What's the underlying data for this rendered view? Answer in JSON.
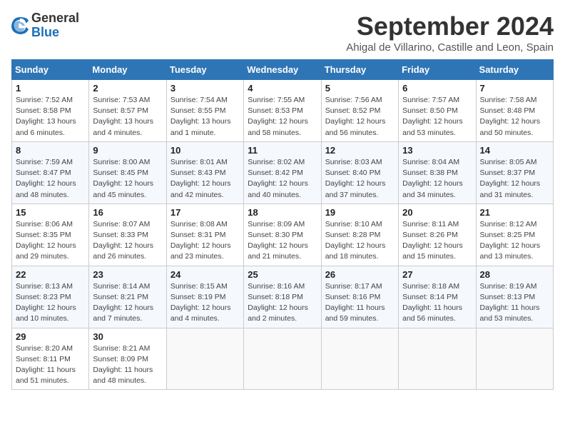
{
  "header": {
    "logo": {
      "line1": "General",
      "line2": "Blue"
    },
    "title": "September 2024",
    "subtitle": "Ahigal de Villarino, Castille and Leon, Spain"
  },
  "weekdays": [
    "Sunday",
    "Monday",
    "Tuesday",
    "Wednesday",
    "Thursday",
    "Friday",
    "Saturday"
  ],
  "weeks": [
    [
      {
        "day": "1",
        "info": "Sunrise: 7:52 AM\nSunset: 8:58 PM\nDaylight: 13 hours\nand 6 minutes."
      },
      {
        "day": "2",
        "info": "Sunrise: 7:53 AM\nSunset: 8:57 PM\nDaylight: 13 hours\nand 4 minutes."
      },
      {
        "day": "3",
        "info": "Sunrise: 7:54 AM\nSunset: 8:55 PM\nDaylight: 13 hours\nand 1 minute."
      },
      {
        "day": "4",
        "info": "Sunrise: 7:55 AM\nSunset: 8:53 PM\nDaylight: 12 hours\nand 58 minutes."
      },
      {
        "day": "5",
        "info": "Sunrise: 7:56 AM\nSunset: 8:52 PM\nDaylight: 12 hours\nand 56 minutes."
      },
      {
        "day": "6",
        "info": "Sunrise: 7:57 AM\nSunset: 8:50 PM\nDaylight: 12 hours\nand 53 minutes."
      },
      {
        "day": "7",
        "info": "Sunrise: 7:58 AM\nSunset: 8:48 PM\nDaylight: 12 hours\nand 50 minutes."
      }
    ],
    [
      {
        "day": "8",
        "info": "Sunrise: 7:59 AM\nSunset: 8:47 PM\nDaylight: 12 hours\nand 48 minutes."
      },
      {
        "day": "9",
        "info": "Sunrise: 8:00 AM\nSunset: 8:45 PM\nDaylight: 12 hours\nand 45 minutes."
      },
      {
        "day": "10",
        "info": "Sunrise: 8:01 AM\nSunset: 8:43 PM\nDaylight: 12 hours\nand 42 minutes."
      },
      {
        "day": "11",
        "info": "Sunrise: 8:02 AM\nSunset: 8:42 PM\nDaylight: 12 hours\nand 40 minutes."
      },
      {
        "day": "12",
        "info": "Sunrise: 8:03 AM\nSunset: 8:40 PM\nDaylight: 12 hours\nand 37 minutes."
      },
      {
        "day": "13",
        "info": "Sunrise: 8:04 AM\nSunset: 8:38 PM\nDaylight: 12 hours\nand 34 minutes."
      },
      {
        "day": "14",
        "info": "Sunrise: 8:05 AM\nSunset: 8:37 PM\nDaylight: 12 hours\nand 31 minutes."
      }
    ],
    [
      {
        "day": "15",
        "info": "Sunrise: 8:06 AM\nSunset: 8:35 PM\nDaylight: 12 hours\nand 29 minutes."
      },
      {
        "day": "16",
        "info": "Sunrise: 8:07 AM\nSunset: 8:33 PM\nDaylight: 12 hours\nand 26 minutes."
      },
      {
        "day": "17",
        "info": "Sunrise: 8:08 AM\nSunset: 8:31 PM\nDaylight: 12 hours\nand 23 minutes."
      },
      {
        "day": "18",
        "info": "Sunrise: 8:09 AM\nSunset: 8:30 PM\nDaylight: 12 hours\nand 21 minutes."
      },
      {
        "day": "19",
        "info": "Sunrise: 8:10 AM\nSunset: 8:28 PM\nDaylight: 12 hours\nand 18 minutes."
      },
      {
        "day": "20",
        "info": "Sunrise: 8:11 AM\nSunset: 8:26 PM\nDaylight: 12 hours\nand 15 minutes."
      },
      {
        "day": "21",
        "info": "Sunrise: 8:12 AM\nSunset: 8:25 PM\nDaylight: 12 hours\nand 13 minutes."
      }
    ],
    [
      {
        "day": "22",
        "info": "Sunrise: 8:13 AM\nSunset: 8:23 PM\nDaylight: 12 hours\nand 10 minutes."
      },
      {
        "day": "23",
        "info": "Sunrise: 8:14 AM\nSunset: 8:21 PM\nDaylight: 12 hours\nand 7 minutes."
      },
      {
        "day": "24",
        "info": "Sunrise: 8:15 AM\nSunset: 8:19 PM\nDaylight: 12 hours\nand 4 minutes."
      },
      {
        "day": "25",
        "info": "Sunrise: 8:16 AM\nSunset: 8:18 PM\nDaylight: 12 hours\nand 2 minutes."
      },
      {
        "day": "26",
        "info": "Sunrise: 8:17 AM\nSunset: 8:16 PM\nDaylight: 11 hours\nand 59 minutes."
      },
      {
        "day": "27",
        "info": "Sunrise: 8:18 AM\nSunset: 8:14 PM\nDaylight: 11 hours\nand 56 minutes."
      },
      {
        "day": "28",
        "info": "Sunrise: 8:19 AM\nSunset: 8:13 PM\nDaylight: 11 hours\nand 53 minutes."
      }
    ],
    [
      {
        "day": "29",
        "info": "Sunrise: 8:20 AM\nSunset: 8:11 PM\nDaylight: 11 hours\nand 51 minutes."
      },
      {
        "day": "30",
        "info": "Sunrise: 8:21 AM\nSunset: 8:09 PM\nDaylight: 11 hours\nand 48 minutes."
      },
      null,
      null,
      null,
      null,
      null
    ]
  ]
}
